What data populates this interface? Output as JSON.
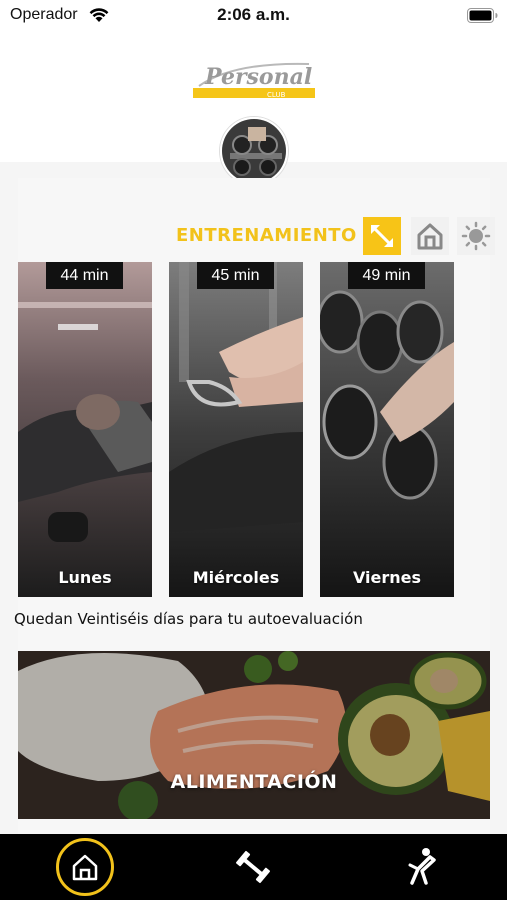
{
  "status_bar": {
    "carrier": "Operador",
    "time": "2:06 a.m."
  },
  "logo": {
    "text": "Personal",
    "subtext": "CLUB"
  },
  "section": {
    "title": "ENTRENAMIENTO"
  },
  "workouts": [
    {
      "duration": "44 min",
      "day": "Lunes"
    },
    {
      "duration": "45 min",
      "day": "Miércoles"
    },
    {
      "duration": "49 min",
      "day": "Viernes"
    }
  ],
  "countdown_text": "Quedan Veintiséis días para tu autoevaluación",
  "nutrition": {
    "label": "ALIMENTACIÓN"
  },
  "tabs": [
    {
      "icon": "home-icon",
      "active": true
    },
    {
      "icon": "dumbbell-icon",
      "active": false
    },
    {
      "icon": "stretching-icon",
      "active": false
    }
  ],
  "colors": {
    "accent": "#f2c21b",
    "tab_bar": "#000000"
  }
}
